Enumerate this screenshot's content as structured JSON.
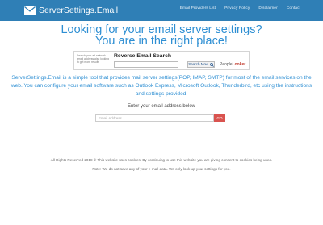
{
  "header": {
    "brand": "ServerSettings.Email",
    "nav": [
      "Email Providers List",
      "Privacy Policy",
      "Disclaimer",
      "Contact"
    ]
  },
  "hero": {
    "line1": "Looking for your email server settings?",
    "line2": "You are in the right place!"
  },
  "ad": {
    "thumb_text": "Search your ad network email address also looking to get more results",
    "title": "Reverse Email Search",
    "button": "Search Now",
    "provider_prefix": "People",
    "provider_name": "Looker"
  },
  "description": "ServerSettings.Email is a simple tool that provides mail server settings(POP, IMAP, SMTP) for most of the email services on the web. You can configure your email software such as Outlook Express, Microsoft Outlook, Thunderbird, etc using the instructions and settings provided.",
  "form": {
    "label": "Enter your email address below",
    "placeholder": "Email Address",
    "button": "GO"
  },
  "footer": {
    "line1": "All Rights Reserved 2018 © This website uses cookies. By continuing to use this website you are giving consent to cookies being used.",
    "line2": "Note: We do not save any of your e-mail data. We only look up your settings for you."
  },
  "colors": {
    "navbar": "#2f7fb6",
    "accent": "#2e8fd3",
    "go_button": "#d9534f"
  }
}
